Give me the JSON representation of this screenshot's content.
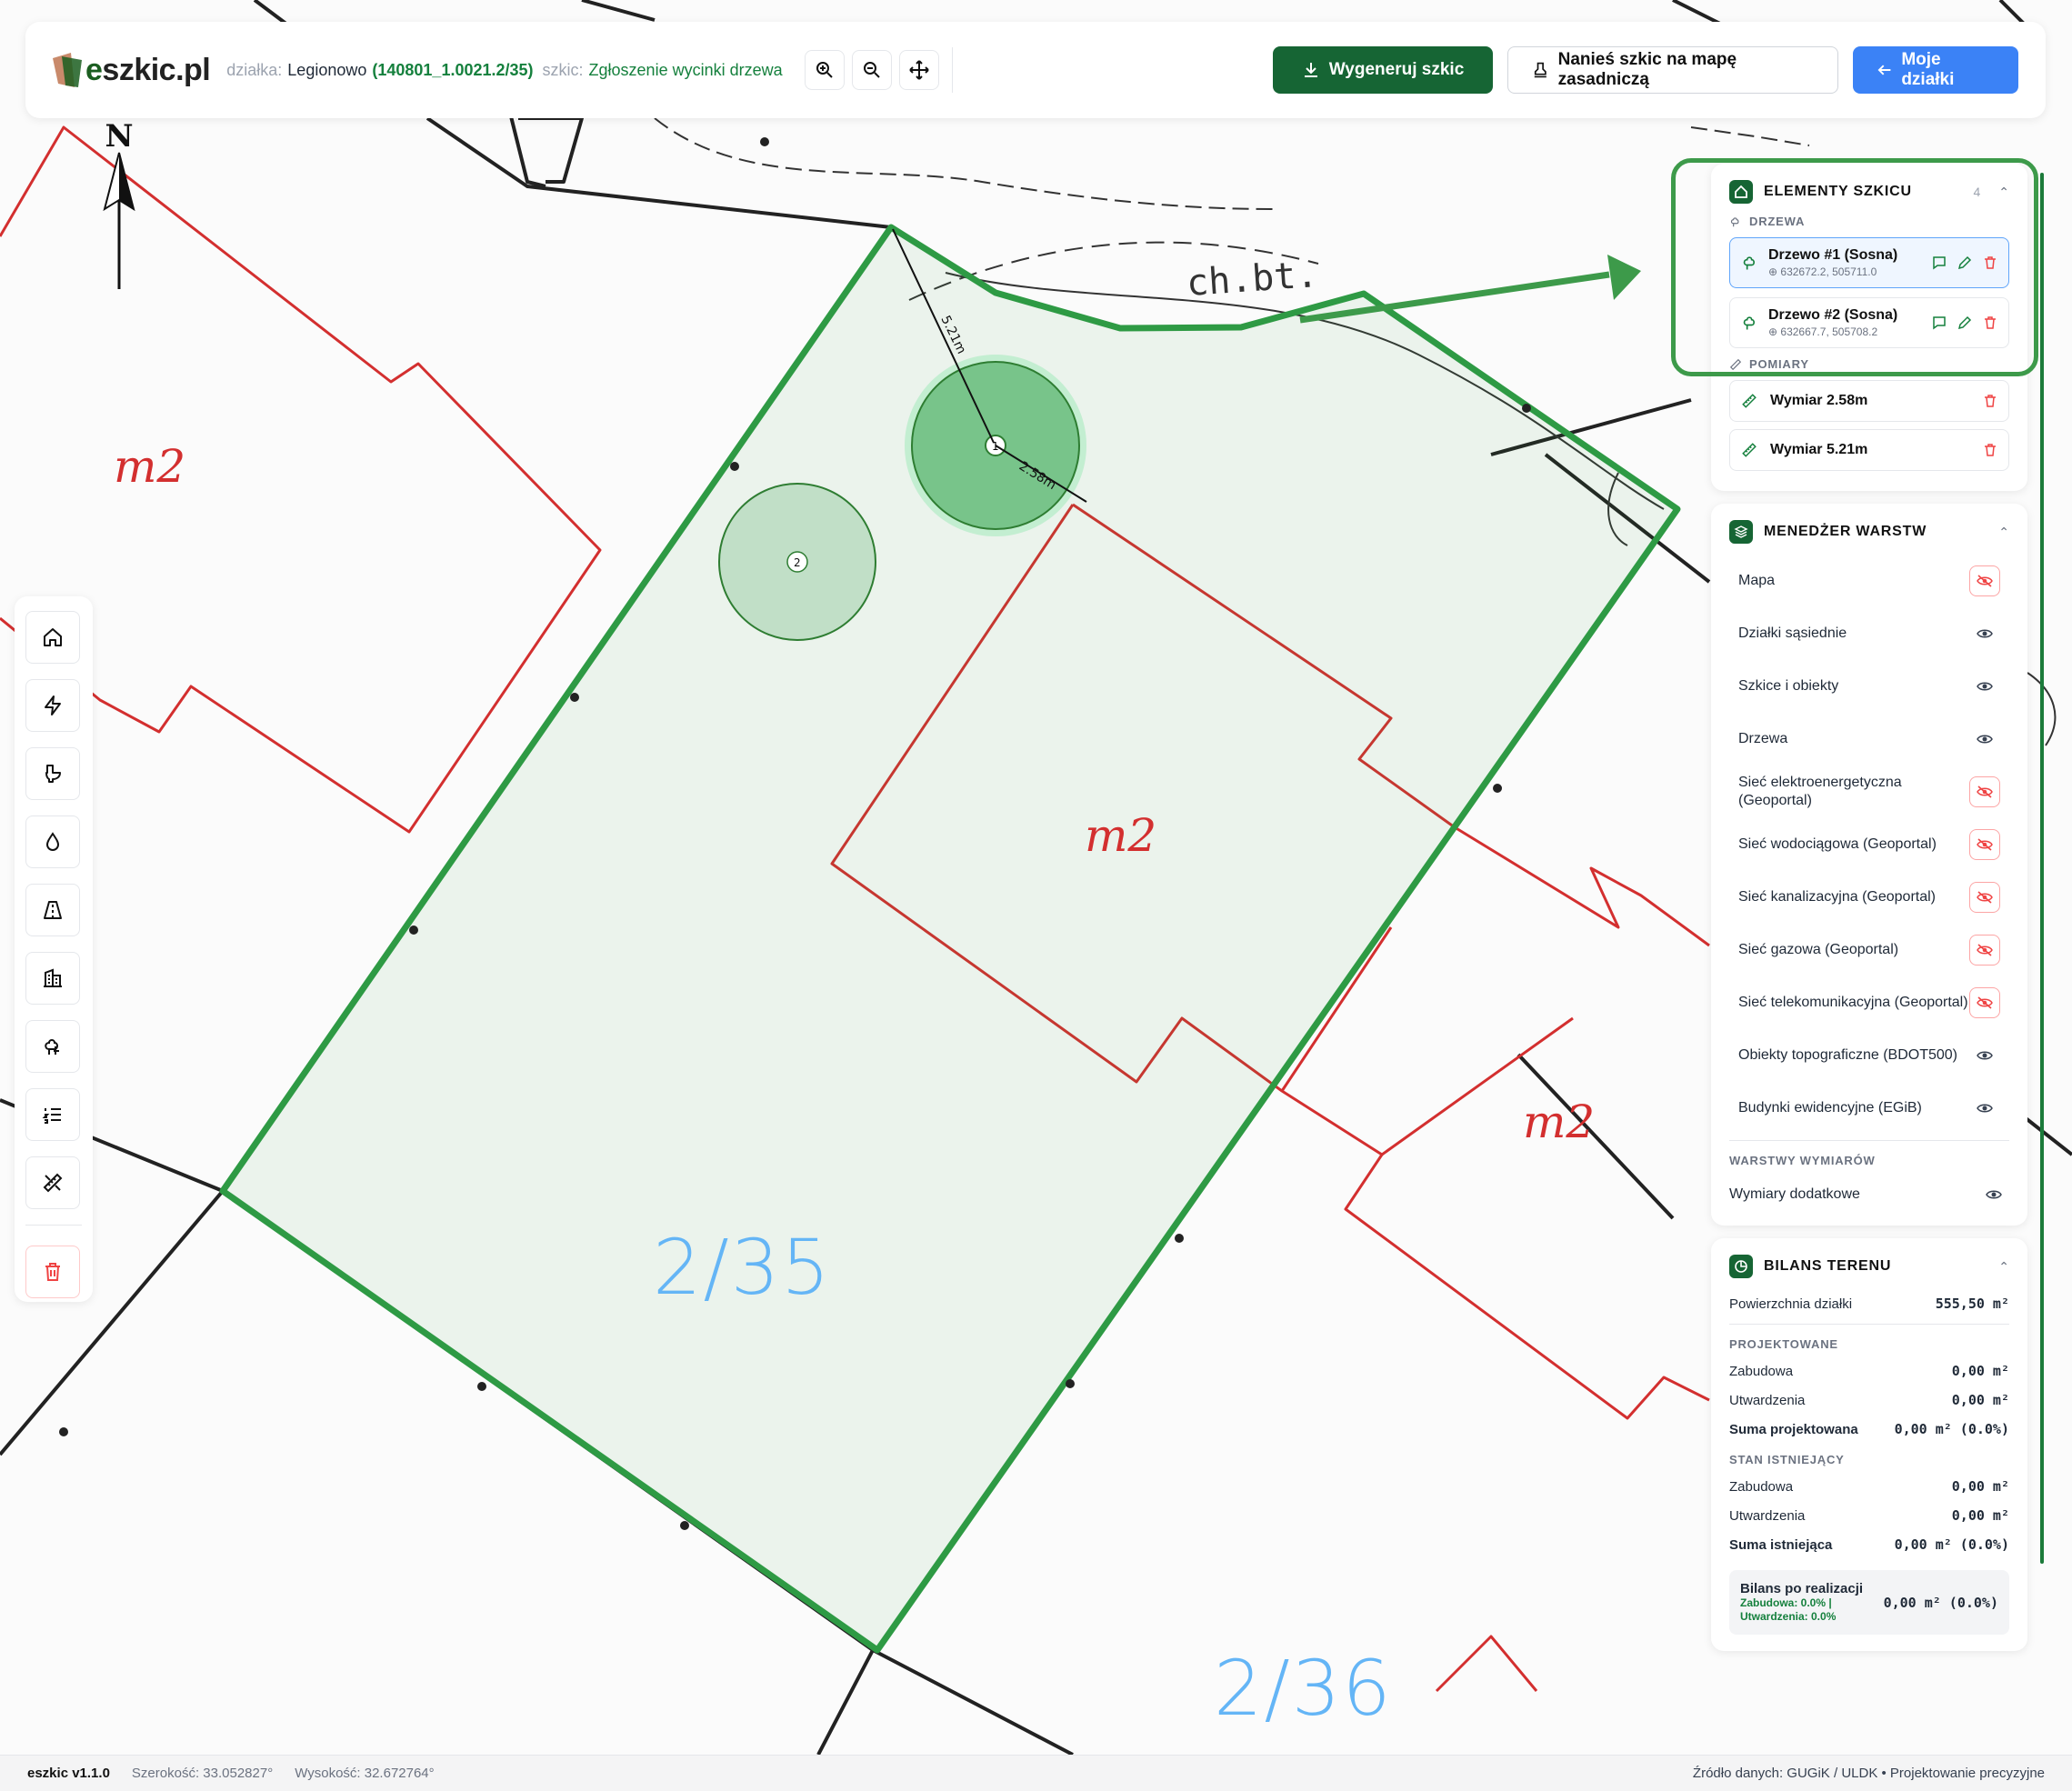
{
  "app": {
    "logo_text": "szkic.pl",
    "logo_letter": "e"
  },
  "breadcrumb": {
    "dzialka_label": "działka:",
    "dzialka_city": "Legionowo",
    "dzialka_id": "(140801_1.0021.2/35)",
    "szkic_label": "szkic:",
    "szkic_value": "Zgłoszenie wycinki drzewa"
  },
  "toolbar": {
    "zoom_in_icon": "zoom-in-icon",
    "zoom_out_icon": "zoom-out-icon",
    "pan_icon": "move-icon",
    "generate_label": "Wygeneruj szkic",
    "apply_label": "Nanieś szkic na mapę zasadniczą",
    "my_parcels_label": "Moje działki"
  },
  "map": {
    "north_label": "N",
    "labels": {
      "m2_a": "m2",
      "m2_b": "m2",
      "m2_c": "m2",
      "parcel_main": "2/35",
      "parcel_next": "2/36",
      "chbt": "ch.bt."
    },
    "tree1_number": "1",
    "tree2_number": "2",
    "dim1_label": "5.21m",
    "dim2_label": "2.58m"
  },
  "left_tools": [
    {
      "name": "home-icon"
    },
    {
      "name": "electricity-icon"
    },
    {
      "name": "toilet-icon"
    },
    {
      "name": "water-drop-icon"
    },
    {
      "name": "road-icon"
    },
    {
      "name": "building-icon"
    },
    {
      "name": "tree-icon"
    },
    {
      "name": "list-icon"
    },
    {
      "name": "measure-icon"
    },
    {
      "name": "trash-icon"
    }
  ],
  "elements": {
    "title": "ELEMENTY SZKICU",
    "count": "4",
    "trees_head": "DRZEWA",
    "trees": [
      {
        "name": "Drzewo #1 (Sosna)",
        "coords": "632672.2, 505711.0"
      },
      {
        "name": "Drzewo #2 (Sosna)",
        "coords": "632667.7, 505708.2"
      }
    ],
    "measures_head": "POMIARY",
    "measures": [
      {
        "name": "Wymiar 2.58m"
      },
      {
        "name": "Wymiar 5.21m"
      }
    ]
  },
  "layers": {
    "title": "MENEDŻER WARSTW",
    "items": [
      {
        "name": "Mapa",
        "visible": false
      },
      {
        "name": "Działki sąsiednie",
        "visible": true
      },
      {
        "name": "Szkice i obiekty",
        "visible": true
      },
      {
        "name": "Drzewa",
        "visible": true
      },
      {
        "name": "Sieć elektroenergetyczna (Geoportal)",
        "visible": false
      },
      {
        "name": "Sieć wodociągowa (Geoportal)",
        "visible": false
      },
      {
        "name": "Sieć kanalizacyjna (Geoportal)",
        "visible": false
      },
      {
        "name": "Sieć gazowa (Geoportal)",
        "visible": false
      },
      {
        "name": "Sieć telekomunikacyjna (Geoportal)",
        "visible": false
      },
      {
        "name": "Obiekty topograficzne (BDOT500)",
        "visible": true
      },
      {
        "name": "Budynki ewidencyjne (EGiB)",
        "visible": true
      }
    ],
    "dim_head": "WARSTWY WYMIARÓW",
    "dim_item": "Wymiary dodatkowe"
  },
  "balance": {
    "title": "BILANS TERENU",
    "area_label": "Powierzchnia działki",
    "area_value": "555,50 m²",
    "projected_head": "PROJEKTOWANE",
    "proj_build_label": "Zabudowa",
    "proj_build_value": "0,00 m²",
    "proj_paved_label": "Utwardzenia",
    "proj_paved_value": "0,00 m²",
    "proj_sum_label": "Suma projektowana",
    "proj_sum_value": "0,00 m² (0.0%)",
    "existing_head": "STAN ISTNIEJĄCY",
    "ex_build_label": "Zabudowa",
    "ex_build_value": "0,00 m²",
    "ex_paved_label": "Utwardzenia",
    "ex_paved_value": "0,00 m²",
    "ex_sum_label": "Suma istniejąca",
    "ex_sum_value": "0,00 m² (0.0%)",
    "after_label": "Bilans po realizacji",
    "after_build": "Zabudowa: 0.0% |",
    "after_paved": "Utwardzenia: 0.0%",
    "after_value": "0,00 m² (0.0%)"
  },
  "status": {
    "version": "eszkic v1.1.0",
    "lat": "Szerokość: 33.052827°",
    "lon": "Wysokość: 32.672764°",
    "source": "Źródło danych: GUGiK / ULDK • Projektowanie precyzyjne"
  },
  "colors": {
    "accent_green": "#166534",
    "parcel_green": "#2e9a44",
    "boundary_red": "#d32f2f",
    "blue": "#3b82f6"
  }
}
